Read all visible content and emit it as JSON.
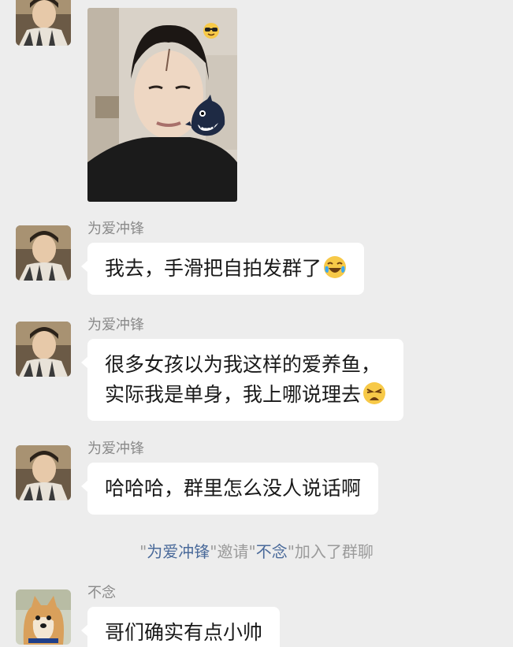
{
  "messages": [
    {
      "sender": "为爱冲锋",
      "type": "image",
      "badge_icon": "sunglasses-emoji-icon",
      "sticker_icon": "shark-sticker-icon"
    },
    {
      "sender": "为爱冲锋",
      "type": "text",
      "text": "我去，手滑把自拍发群了",
      "emoji_icon": "crying-laughing-emoji-icon"
    },
    {
      "sender": "为爱冲锋",
      "type": "text",
      "line1": "很多女孩以为我这样的爱养鱼，",
      "line2": "实际我是单身，我上哪说理去",
      "emoji_icon": "weary-face-emoji-icon"
    },
    {
      "sender": "为爱冲锋",
      "type": "text",
      "text": "哈哈哈，群里怎么没人说话啊"
    },
    {
      "sender": "不念",
      "type": "text",
      "text": "哥们确实有点小帅"
    }
  ],
  "system_notice": {
    "q1": "\"",
    "inviter": "为爱冲锋",
    "q2": "\"邀请\"",
    "invitee": "不念",
    "q3": "\"加入了群聊"
  },
  "colors": {
    "background": "#ededed",
    "bubble": "#ffffff",
    "sender_name": "#8a8a8a",
    "system_text": "#9b9b9b",
    "system_highlight": "#4a6a9a"
  }
}
